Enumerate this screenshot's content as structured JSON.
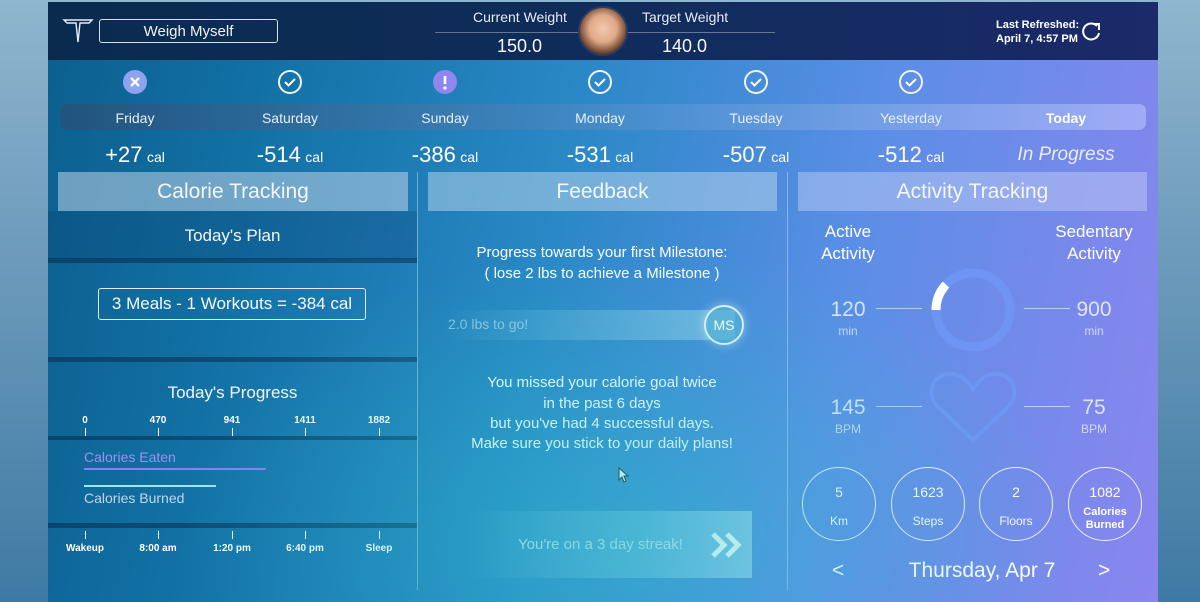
{
  "header": {
    "weigh_button": "Weigh Myself",
    "current_weight_label": "Current Weight",
    "current_weight": "150.0",
    "target_weight_label": "Target Weight",
    "target_weight": "140.0",
    "last_refreshed_label": "Last Refreshed:",
    "last_refreshed_value": "April 7, 4:57 PM"
  },
  "days": [
    {
      "name": "Friday",
      "status": "missed",
      "cal_num": "+27",
      "cal_unit": "cal"
    },
    {
      "name": "Saturday",
      "status": "ok",
      "cal_num": "-514",
      "cal_unit": "cal"
    },
    {
      "name": "Sunday",
      "status": "warning",
      "cal_num": "-386",
      "cal_unit": "cal"
    },
    {
      "name": "Monday",
      "status": "ok",
      "cal_num": "-531",
      "cal_unit": "cal"
    },
    {
      "name": "Tuesday",
      "status": "ok",
      "cal_num": "-507",
      "cal_unit": "cal"
    },
    {
      "name": "Yesterday",
      "status": "ok",
      "cal_num": "-512",
      "cal_unit": "cal"
    },
    {
      "name": "Today",
      "status": "current",
      "cal_text": "In Progress"
    }
  ],
  "calorie_tracking": {
    "title": "Calorie Tracking",
    "plan_title": "Today's Plan",
    "plan_summary": "3 Meals - 1 Workouts = -384 cal",
    "progress_title": "Today's Progress",
    "scale": [
      "0",
      "470",
      "941",
      "1411",
      "1882"
    ],
    "calories_eaten_label": "Calories Eaten",
    "calories_eaten_fraction": 0.62,
    "calories_burned_label": "Calories Burned",
    "calories_burned_fraction": 0.45,
    "times": [
      "Wakeup",
      "8:00 am",
      "1:20 pm",
      "6:40 pm",
      "Sleep"
    ],
    "colors": {
      "eaten": "#8f7df0",
      "burned": "#9ee6f0"
    }
  },
  "feedback": {
    "title": "Feedback",
    "milestone_line1": "Progress towards your first Milestone:",
    "milestone_line2": "( lose 2 lbs to achieve a Milestone )",
    "progress_text": "2.0 lbs to go!",
    "badge": "MS",
    "message_lines": [
      "You missed your calorie goal twice",
      "in the past 6 days",
      "but you've had 4 successful days.",
      "Make sure you stick to your daily plans!"
    ],
    "streak_text": "You're on a 3 day streak!"
  },
  "activity": {
    "title": "Activity Tracking",
    "active_label_1": "Active",
    "active_label_2": "Activity",
    "sedentary_label_1": "Sedentary",
    "sedentary_label_2": "Activity",
    "active_min": "120",
    "sedentary_min": "900",
    "min_unit": "min",
    "active_ring_fraction": 0.12,
    "bpm_high": "145",
    "bpm_low": "75",
    "bpm_unit": "BPM",
    "stats": [
      {
        "value": "5",
        "unit": "Km"
      },
      {
        "value": "1623",
        "unit": "Steps"
      },
      {
        "value": "2",
        "unit": "Floors"
      },
      {
        "value": "1082",
        "unit": "Calories Burned"
      }
    ],
    "date": "Thursday, Apr 7",
    "prev_arrow": "<",
    "next_arrow": ">"
  }
}
